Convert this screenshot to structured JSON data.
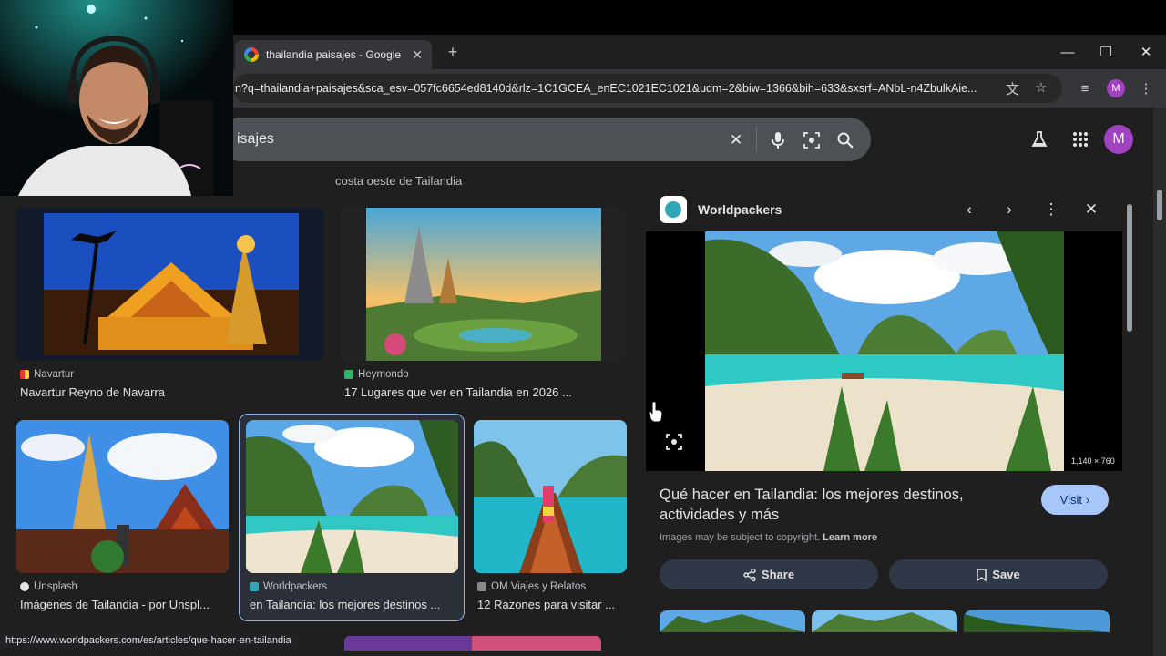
{
  "tab": {
    "title": "thailandia paisajes - Google Se"
  },
  "address_bar": {
    "url": "n?q=thailandia+paisajes&sca_esv=057fc6654ed8140d&rlz=1C1GCEA_enEC1021EC1021&udm=2&biw=1366&bih=633&sxsrf=ANbL-n4ZbulkAie..."
  },
  "profile": {
    "initial": "M"
  },
  "search": {
    "query": "isajes"
  },
  "related": "costa oeste de Tailandia",
  "results": [
    {
      "source": "Navartur",
      "title": "Navartur Reyno de Navarra"
    },
    {
      "source": "Heymondo",
      "title": "17 Lugares que ver en Tailandia en 2026 ..."
    },
    {
      "source": "Unsplash",
      "title": "Imágenes de Tailandia - por Unspl..."
    },
    {
      "source": "Worldpackers",
      "title": "en Tailandia: los mejores destinos ..."
    },
    {
      "source": "OM Viajes y Relatos",
      "title": "12 Razones para visitar ..."
    }
  ],
  "panel": {
    "site": "Worldpackers",
    "dimensions": "1,140 × 760",
    "title": "Qué hacer en Tailandia: los mejores destinos, actividades y más",
    "visit_label": "Visit",
    "copyright": "Images may be subject to copyright.",
    "learn_more": "Learn more",
    "share_label": "Share",
    "save_label": "Save"
  },
  "status_url": "https://www.worldpackers.com/es/articles/que-hacer-en-tailandia",
  "colors": {
    "accent": "#a8c7fa",
    "avatar": "#a142c0",
    "selection": "#8ab4f8"
  }
}
